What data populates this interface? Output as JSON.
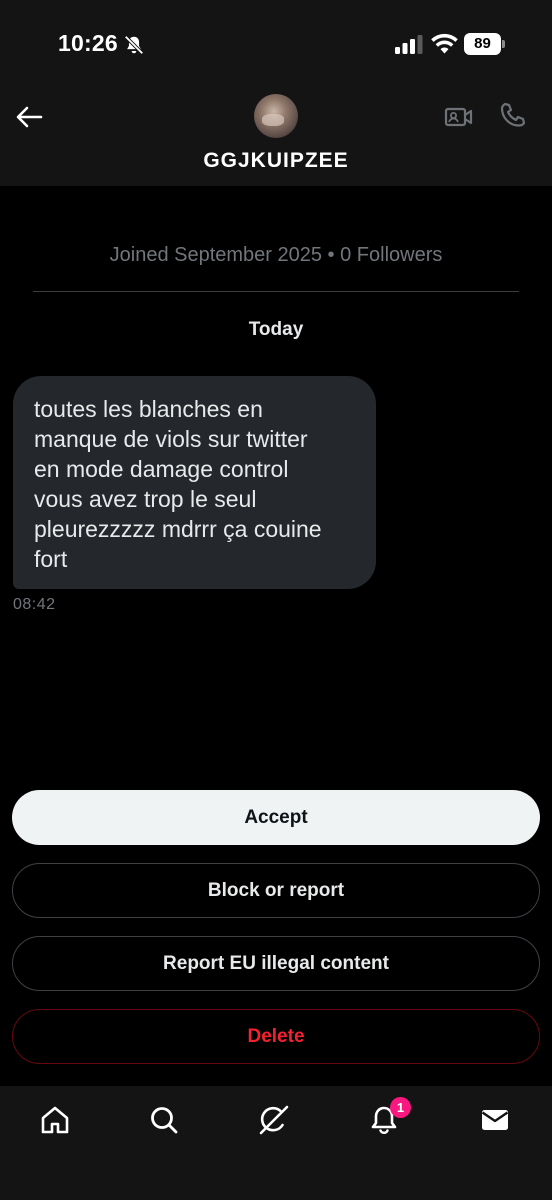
{
  "status_bar": {
    "time": "10:26",
    "battery": "89",
    "icons": [
      "bell-off-icon",
      "signal-icon",
      "wifi-icon",
      "battery-icon"
    ]
  },
  "header": {
    "contact_name": "GGJKUIPZEE",
    "icons": [
      "back-arrow-icon",
      "video-call-icon",
      "phone-icon"
    ]
  },
  "conversation": {
    "joined_info": "Joined September 2025 • 0 Followers",
    "day_label": "Today",
    "messages": [
      {
        "lines": [
          "toutes les blanches en",
          "manque de viols sur twitter",
          "en mode damage control",
          "vous avez trop le seul",
          "pleurezzzzz mdrrr ça couine",
          "fort"
        ],
        "time": "08:42"
      }
    ]
  },
  "actions": {
    "accept": "Accept",
    "block_or_report": "Block or report",
    "report_eu": "Report EU illegal content",
    "delete": "Delete"
  },
  "bottom_nav": {
    "items": [
      "home-icon",
      "search-icon",
      "grok-icon",
      "notifications-icon",
      "messages-icon"
    ],
    "notifications_badge": "1"
  },
  "colors": {
    "background": "#000000",
    "bar_background": "#141414",
    "bubble": "#24272b",
    "muted_text": "#71767b",
    "delete_red": "#f4212e",
    "badge_pink": "#f91880",
    "accept_bg": "#eff3f4"
  }
}
